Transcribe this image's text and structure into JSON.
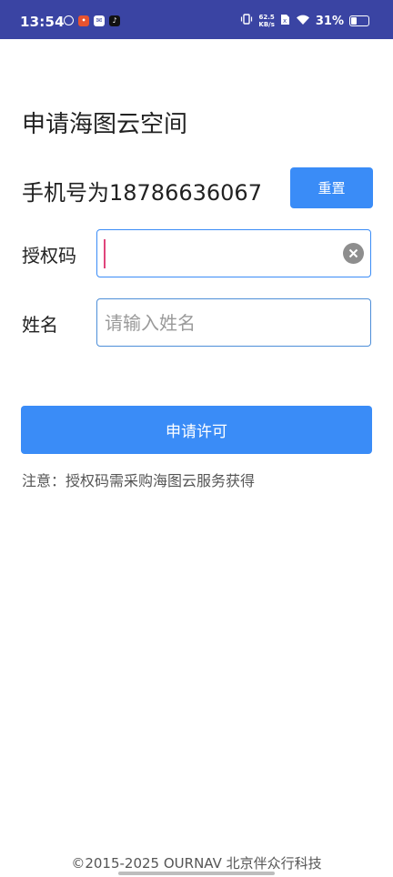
{
  "status_bar": {
    "time": "13:54",
    "net_speed_value": "62.5",
    "net_speed_unit": "KB/s",
    "battery_percent": "31%",
    "app_icons": [
      "sync-icon",
      "app-badge-icon",
      "mail-icon",
      "tiktok-icon"
    ]
  },
  "page": {
    "title": "申请海图云空间",
    "phone_label": "手机号为18786636067",
    "reset_label": "重置",
    "auth_code": {
      "label": "授权码",
      "value": "",
      "placeholder": ""
    },
    "name": {
      "label": "姓名",
      "value": "",
      "placeholder": "请输入姓名"
    },
    "apply_label": "申请许可",
    "note": "注意：授权码需采购海图云服务获得"
  },
  "footer": {
    "copyright": "©2015-2025 OURNAV 北京伴众行科技"
  },
  "colors": {
    "status_bar_bg": "#3a44a3",
    "accent": "#3a8cf7",
    "caret": "#e0457b"
  }
}
